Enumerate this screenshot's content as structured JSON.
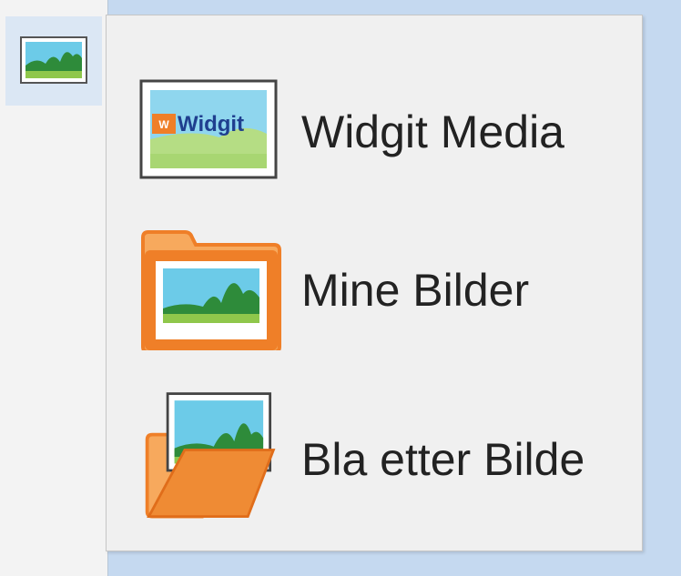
{
  "toolbar": {
    "insert_image_icon": "picture-icon"
  },
  "menu": {
    "items": [
      {
        "label": "Widgit Media",
        "icon": "widgit-media-icon",
        "logo_text": "Widgit"
      },
      {
        "label": "Mine Bilder",
        "icon": "picture-folder-icon"
      },
      {
        "label": "Bla etter Bilde",
        "icon": "open-folder-picture-icon"
      }
    ]
  },
  "colors": {
    "background": "#c5d9f0",
    "menu_bg": "#f0f0f0",
    "folder_orange": "#ef7f28",
    "sky": "#6ccbe8",
    "grass": "#8fc74b",
    "hill": "#2e8b3a"
  }
}
